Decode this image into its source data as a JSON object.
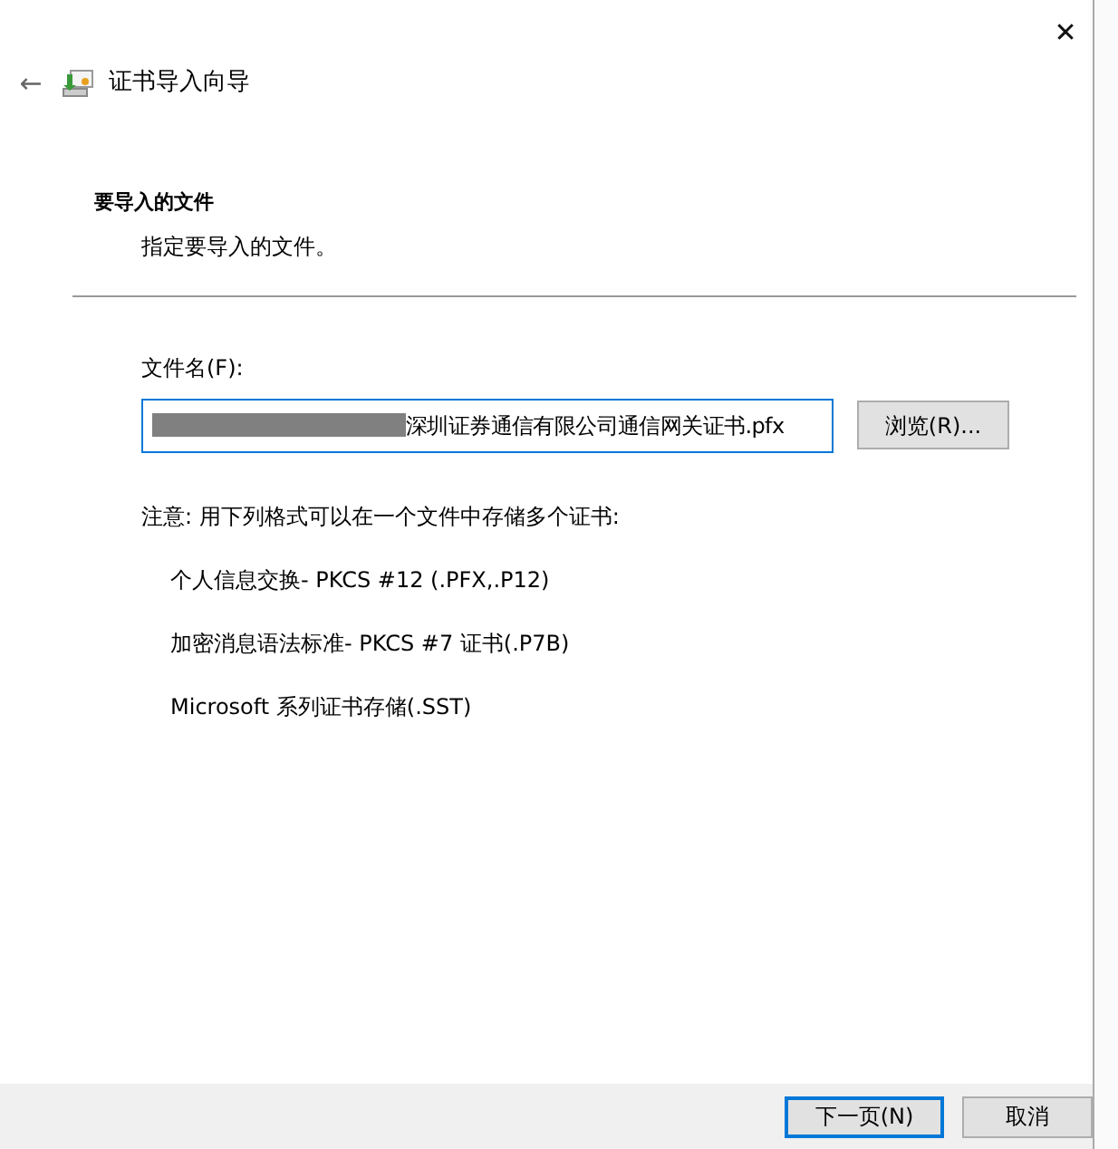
{
  "window": {
    "close": "✕",
    "back": "←",
    "title": "证书导入向导"
  },
  "header": {
    "heading": "要导入的文件",
    "subheading": "指定要导入的文件。"
  },
  "file": {
    "label": "文件名(F):",
    "value": "深圳证券通信有限公司通信网关证书.pfx",
    "redacted": true,
    "browse": "浏览(R)..."
  },
  "note": "注意: 用下列格式可以在一个文件中存储多个证书:",
  "formats": [
    "个人信息交换- PKCS #12 (.PFX,.P12)",
    "加密消息语法标准- PKCS #7 证书(.P7B)",
    "Microsoft 系列证书存储(.SST)"
  ],
  "buttons": [
    {
      "label": "下一页(N)",
      "selected": true
    },
    {
      "label": "取消",
      "selected": false
    }
  ]
}
